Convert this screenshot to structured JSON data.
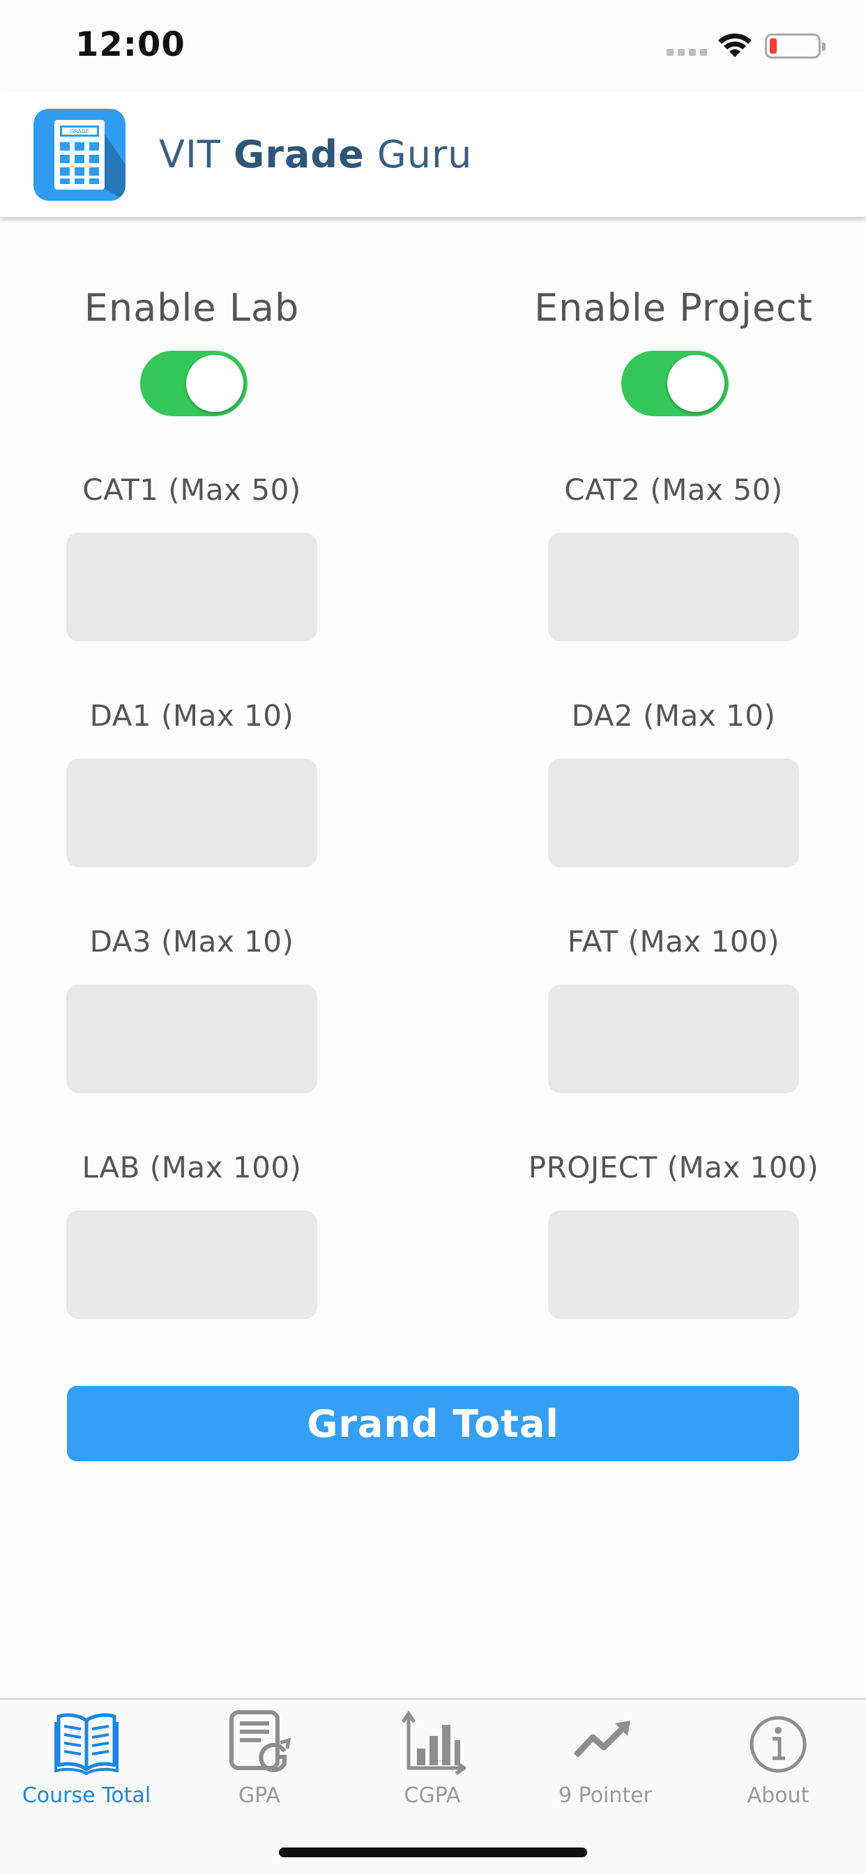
{
  "status_bar": {
    "time": "12:00"
  },
  "header": {
    "title_prefix": "VIT ",
    "title_bold": "Grade",
    "title_suffix": " Guru",
    "logo_text": "GRADE"
  },
  "toggles": {
    "lab": {
      "label": "Enable Lab",
      "on": true
    },
    "project": {
      "label": "Enable Project",
      "on": true
    }
  },
  "fields": {
    "cat1": {
      "label": "CAT1 (Max 50)",
      "value": ""
    },
    "cat2": {
      "label": "CAT2 (Max 50)",
      "value": ""
    },
    "da1": {
      "label": "DA1 (Max 10)",
      "value": ""
    },
    "da2": {
      "label": "DA2 (Max 10)",
      "value": ""
    },
    "da3": {
      "label": "DA3 (Max 10)",
      "value": ""
    },
    "fat": {
      "label": "FAT (Max 100)",
      "value": ""
    },
    "lab": {
      "label": "LAB (Max 100)",
      "value": ""
    },
    "project": {
      "label": "PROJECT (Max 100)",
      "value": ""
    }
  },
  "grand_total_label": "Grand Total",
  "tabs": [
    {
      "label": "Course Total",
      "icon": "open-book-icon",
      "active": true
    },
    {
      "label": "GPA",
      "icon": "gpa-document-icon",
      "active": false
    },
    {
      "label": "CGPA",
      "icon": "bar-chart-icon",
      "active": false
    },
    {
      "label": "9 Pointer",
      "icon": "trending-up-icon",
      "active": false
    },
    {
      "label": "About",
      "icon": "info-icon",
      "active": false
    }
  ],
  "colors": {
    "accent": "#349ff4",
    "toggle_on": "#34c759",
    "tab_active": "#1a86e6",
    "tab_inactive": "#999999"
  }
}
